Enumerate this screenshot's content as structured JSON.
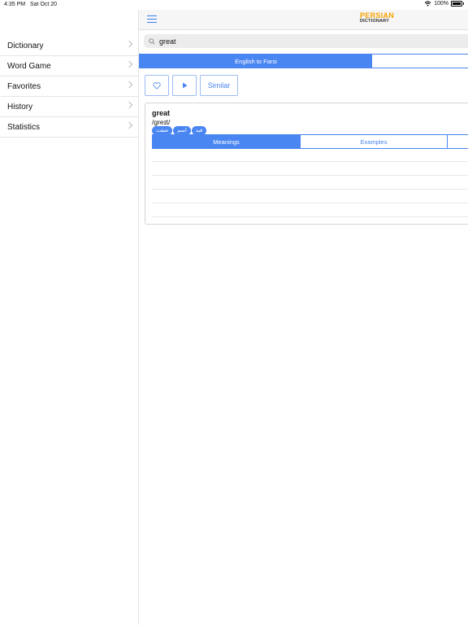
{
  "status": {
    "time": "4:35 PM",
    "date": "Sat Oct 20",
    "battery": "100%"
  },
  "sidebar": {
    "items": [
      {
        "label": "Dictionary"
      },
      {
        "label": "Word Game"
      },
      {
        "label": "Favorites"
      },
      {
        "label": "History"
      },
      {
        "label": "Statistics"
      }
    ]
  },
  "header": {
    "logo_line1": "PERSIAN",
    "logo_line2": "DICTIONARY"
  },
  "search": {
    "value": "great"
  },
  "direction": {
    "active": "English to Farsi",
    "other": ""
  },
  "actions": {
    "similar_label": "Similar"
  },
  "entry": {
    "word": "great",
    "phonetic": "/greɪt/",
    "tags": [
      "صفت",
      "اسم",
      "قید"
    ],
    "tabs": [
      "Meanings",
      "Examples",
      ""
    ]
  },
  "colors": {
    "accent": "#4a86f2",
    "logo": "#f6a100"
  },
  "icons": [
    "wifi-icon",
    "battery-icon",
    "chevron-right-icon",
    "menu-icon",
    "search-icon",
    "heart-icon",
    "play-icon"
  ]
}
